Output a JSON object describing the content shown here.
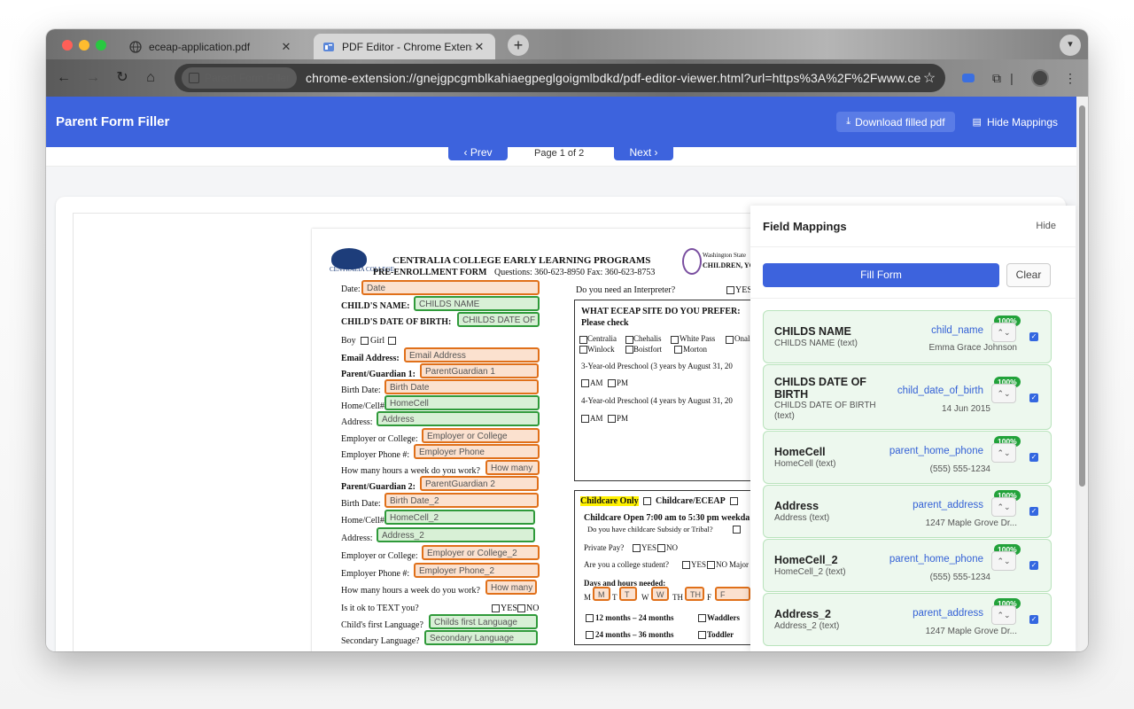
{
  "browser": {
    "tabs": [
      {
        "title": "eceap-application.pdf",
        "icon": "globe-icon"
      },
      {
        "title": "PDF Editor - Chrome Extension",
        "icon": "pdf-editor-icon"
      }
    ],
    "chip_label": "Parent Form Filler",
    "url": "chrome-extension://gnejgpcgmblkahiaegpeglgoigmlbdkd/pdf-editor-viewer.html?url=https%3A%2F%2Fwww.ce..."
  },
  "app": {
    "title": "Parent Form Filler",
    "download_label": "Download filled pdf",
    "hide_mappings_label": "Hide Mappings",
    "prev_label": "Prev",
    "next_label": "Next",
    "page_label": "Page 1 of 2",
    "accent": "#3d63dd"
  },
  "pdf": {
    "org_title": "CENTRALIA COLLEGE EARLY LEARNING PROGRAMS",
    "form_title": "PRE-ENROLLMENT FORM",
    "contact": "Questions: 360-623-8950 Fax: 360-623-8753",
    "logo_text": "CENTRALIA COLLEGE",
    "state_logo_text": "Washington State",
    "state_logo_sub": "CHILDREN, YOUT",
    "left_labels": {
      "date": "Date:",
      "childs_name": "CHILD'S NAME:",
      "childs_dob": "CHILD'S DATE OF BIRTH:",
      "boy": "Boy",
      "girl": "Girl",
      "email": "Email Address:",
      "pg1": "Parent/Guardian 1:",
      "birth_date": "Birth Date:",
      "home_cell": "Home/Cell#",
      "address": "Address:",
      "employer": "Employer or College:",
      "employer_phone": "Employer Phone #:",
      "hours": "How many hours a week do you work?",
      "pg2": "Parent/Guardian 2:",
      "birth_date2": "Birth Date:",
      "home_cell2": "Home/Cell#",
      "address2": "Address:",
      "employer2": "Employer or College:",
      "employer_phone2": "Employer Phone #:",
      "hours2": "How many hours a week do you work?",
      "text_ok": "Is it ok to TEXT you?",
      "yes": "YES",
      "no": "NO",
      "first_language": "Child's first Language?",
      "secondary_language": "Secondary Language?"
    },
    "fields": {
      "date": "Date",
      "childs_name": "CHILDS NAME",
      "childs_dob": "CHILDS DATE OF",
      "email": "Email Address",
      "pg1": "ParentGuardian 1",
      "birth_date": "Birth Date",
      "home_cell": "HomeCell",
      "address": "Address",
      "employer": "Employer or College",
      "employer_phone": "Employer Phone",
      "hours": "How many",
      "pg2": "ParentGuardian 2",
      "birth_date2": "Birth Date_2",
      "home_cell2": "HomeCell_2",
      "address2": "Address_2",
      "employer2": "Employer or College_2",
      "employer_phone2": "Employer Phone_2",
      "hours2": "How many",
      "first_language": "Childs first Language",
      "secondary_language": "Secondary Language"
    },
    "right": {
      "interpreter": "Do you need an Interpreter?",
      "interp_yes": "YES",
      "site_q": "WHAT ECEAP SITE DO YOU PREFER:",
      "please_check": "Please check",
      "site_row1": [
        "Centralia",
        "Chehalis",
        "White Pass",
        "Onal"
      ],
      "site_row2": [
        "Winlock",
        "Boistfort",
        "Morton"
      ],
      "three_yr": "3-Year-old Preschool (3 years by August 31, 20",
      "four_yr": "4-Year-old Preschool (4 years by August 31, 20",
      "am": "AM",
      "pm": "PM",
      "childcare_only": "Childcare Only",
      "childcare_eceap": "Childcare/ECEAP",
      "childcare_open": "Childcare Open 7:00 am to 5:30 pm weekda",
      "subsidy": "Do you have childcare Subsidy or Tribal?",
      "private_pay": "Private Pay?",
      "pp_yes": "YES",
      "pp_no": "NO",
      "student": "Are you a college student?",
      "st_yes": "YES",
      "st_no": "NO",
      "major": "Major",
      "days": "Days and hours needed:",
      "day_letters": [
        "M",
        "T",
        "W",
        "TH",
        "F"
      ],
      "day_fields": [
        "M",
        "T",
        "W",
        "TH",
        "F"
      ],
      "age1": "12 months – 24 months",
      "waddlers": "Waddlers",
      "age2": "24 months – 36 months",
      "toddler": "Toddler"
    }
  },
  "panel": {
    "title": "Field Mappings",
    "hide_label": "Hide",
    "fill_label": "Fill Form",
    "clear_label": "Clear",
    "mappings": [
      {
        "field": "CHILDS NAME",
        "type": "CHILDS NAME (text)",
        "key": "child_name",
        "value": "Emma Grace Johnson",
        "confidence": "100%"
      },
      {
        "field": "CHILDS DATE OF BIRTH",
        "type": "CHILDS DATE OF BIRTH (text)",
        "key": "child_date_of_birth",
        "value": "14 Jun 2015",
        "confidence": "100%"
      },
      {
        "field": "HomeCell",
        "type": "HomeCell (text)",
        "key": "parent_home_phone",
        "value": "(555) 555-1234",
        "confidence": "100%"
      },
      {
        "field": "Address",
        "type": "Address (text)",
        "key": "parent_address",
        "value": "1247 Maple Grove Dr...",
        "confidence": "100%"
      },
      {
        "field": "HomeCell_2",
        "type": "HomeCell_2 (text)",
        "key": "parent_home_phone",
        "value": "(555) 555-1234",
        "confidence": "100%"
      },
      {
        "field": "Address_2",
        "type": "Address_2 (text)",
        "key": "parent_address",
        "value": "1247 Maple Grove Dr...",
        "confidence": "100%"
      }
    ]
  }
}
